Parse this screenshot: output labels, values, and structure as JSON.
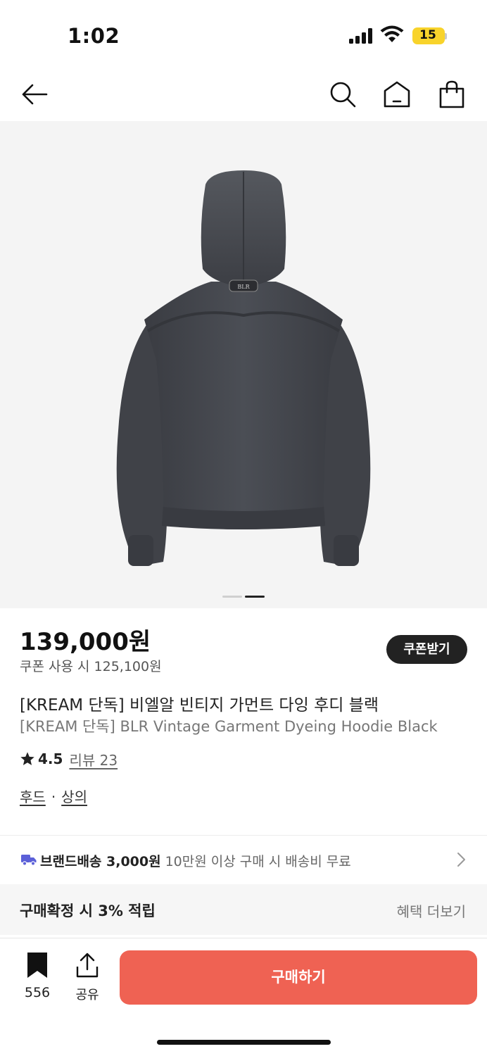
{
  "status_bar": {
    "time": "1:02",
    "battery": "15",
    "battery_color": "#f8d32b"
  },
  "nav": {
    "back_icon": "arrow-left-icon",
    "search_icon": "search-icon",
    "home_icon": "home-icon",
    "bag_icon": "shopping-bag-icon"
  },
  "gallery": {
    "image_subject": "dark charcoal hoodie, back view",
    "label_text": "BLR",
    "current_index": 2,
    "total": 2
  },
  "product": {
    "price": "139,000원",
    "coupon_price": "쿠폰 사용 시 125,100원",
    "coupon_button": "쿠폰받기",
    "title_ko": "[KREAM 단독] 비엘알 빈티지 가먼트 다잉 후디 블랙",
    "title_en": "[KREAM 단독] BLR Vintage Garment Dyeing Hoodie Black",
    "rating": "4.5",
    "review_label": "리뷰 23",
    "categories": [
      "후드",
      "상의"
    ],
    "category_separator": "·"
  },
  "shipping": {
    "label": "브랜드배송 3,000원",
    "sub": "10만원 이상 구매 시 배송비 무료",
    "icon": "truck-icon",
    "icon_color": "#5b60d8"
  },
  "benefit": {
    "label": "구매확정 시 3% 적립",
    "more": "혜택 더보기"
  },
  "bottom_bar": {
    "bookmark_count": "556",
    "share_label": "공유",
    "buy_label": "구매하기",
    "buy_color": "#ef6253"
  }
}
